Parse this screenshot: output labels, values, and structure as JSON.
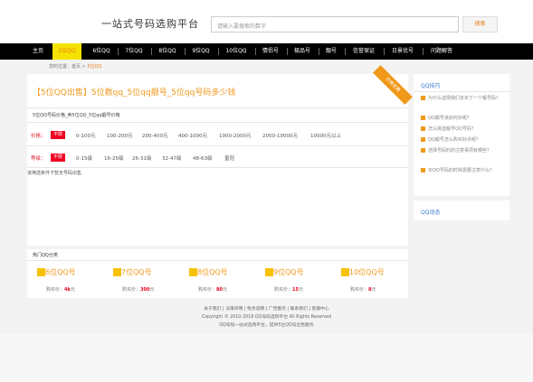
{
  "header": {
    "logo": "一站式号码选购平台",
    "search_placeholder": "请输入要搜索的数字",
    "search_button": "搜索"
  },
  "nav": [
    {
      "label": "主页"
    },
    {
      "label": "5位QQ",
      "active": true
    },
    {
      "label": "6位QQ"
    },
    {
      "label": "7位QQ"
    },
    {
      "label": "8位QQ"
    },
    {
      "label": "9位QQ"
    },
    {
      "label": "10位QQ"
    },
    {
      "label": "情侣号"
    },
    {
      "label": "极品号"
    },
    {
      "label": "靓号"
    },
    {
      "label": "信誉保证"
    },
    {
      "label": "日景优号"
    },
    {
      "label": "问题解答"
    }
  ],
  "breadcrumb": {
    "prefix": "您的位置：",
    "home": "首页",
    "sep": " > ",
    "current": "5位QQ"
  },
  "main": {
    "title": "【5位QQ出售】5位数qq_5位qq靓号_5位qq号码多少钱",
    "ribbon": "价格优惠",
    "subtitle": "5位QQ号码价格_卖5位QQ_5位qq靓号价格",
    "price_label": "价格：",
    "price_tag": "不限",
    "price_options": [
      "0-100元",
      "100-200元",
      "200-400元",
      "400-1000元",
      "1000-2000元",
      "2000-10000元",
      "10000元以上"
    ],
    "level_label": "等级：",
    "level_tag": "不限",
    "level_options": [
      "0-15级",
      "16-25级",
      "26-31级",
      "32-47级",
      "48-63级",
      "皇冠"
    ],
    "empty_text": "该筛选条件下暂无号码出售"
  },
  "sidebar": {
    "title": "QQ技巧",
    "items": [
      "为什么选择我们去买了一个靓号码？",
      "QQ靓号该如何买呢？",
      "怎么挑选靓号QQ号码？",
      "QQ靓号怎么购买好点呢？",
      "选择号码时的注意事项有哪些？",
      "买QQ号码的时候需要注意什么？"
    ],
    "title2": "QQ动态"
  },
  "cards": {
    "title": "热门QQ分类",
    "items": [
      {
        "name": "6位QQ号",
        "price_prefix": "购买价：",
        "price": "4k",
        "unit": "元"
      },
      {
        "name": "7位QQ号",
        "price_prefix": "购买价：",
        "price": "300",
        "unit": "元"
      },
      {
        "name": "8位QQ号",
        "price_prefix": "购买价：",
        "price": "80",
        "unit": "元"
      },
      {
        "name": "9位QQ号",
        "price_prefix": "购买价：",
        "price": "15",
        "unit": "元"
      },
      {
        "name": "10位QQ号",
        "price_prefix": "购买价：",
        "price": "8",
        "unit": "元"
      }
    ]
  },
  "footer": {
    "links": "关于我们 | 法律声明 | 免责说明 | 广告服务 | 联系我们 | 客服中心",
    "copyright": "Copyright © 2010-2018 QQ号码选购平台 All Rights Reserved",
    "note": "QQ号码一站式选购平台，提供5位QQ号出售服务"
  }
}
